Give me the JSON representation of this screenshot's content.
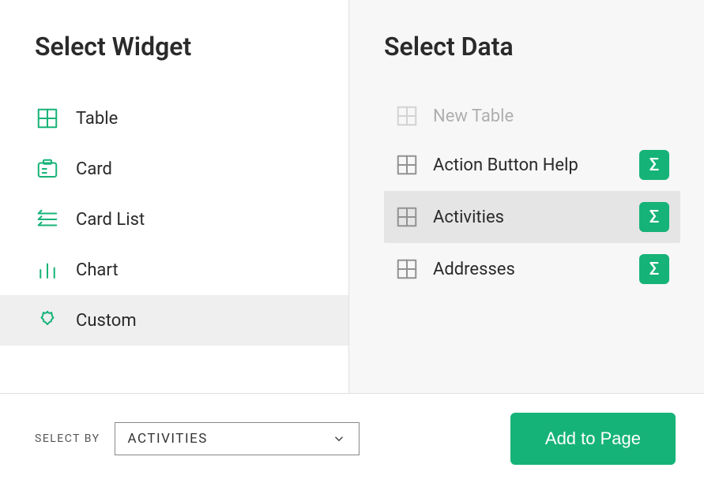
{
  "left": {
    "title": "Select Widget",
    "items": [
      {
        "icon": "table",
        "label": "Table",
        "selected": false
      },
      {
        "icon": "card",
        "label": "Card",
        "selected": false
      },
      {
        "icon": "cardlist",
        "label": "Card List",
        "selected": false
      },
      {
        "icon": "chart",
        "label": "Chart",
        "selected": false
      },
      {
        "icon": "custom",
        "label": "Custom",
        "selected": true
      }
    ]
  },
  "right": {
    "title": "Select Data",
    "items": [
      {
        "icon": "table",
        "label": "New Table",
        "disabled": true,
        "selected": false,
        "sigma": false
      },
      {
        "icon": "table",
        "label": "Action Button Help",
        "disabled": false,
        "selected": false,
        "sigma": true
      },
      {
        "icon": "table",
        "label": "Activities",
        "disabled": false,
        "selected": true,
        "sigma": true
      },
      {
        "icon": "table",
        "label": "Addresses",
        "disabled": false,
        "selected": false,
        "sigma": true
      }
    ]
  },
  "footer": {
    "select_by_label": "SELECT BY",
    "select_by_value": "ACTIVITIES",
    "add_button_label": "Add to Page"
  },
  "colors": {
    "accent": "#16b378"
  }
}
